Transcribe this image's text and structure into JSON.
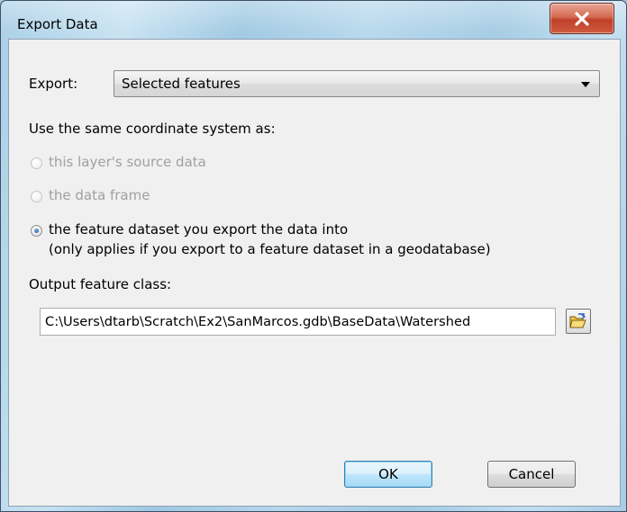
{
  "window": {
    "title": "Export Data"
  },
  "export": {
    "label": "Export:",
    "selected": "Selected features"
  },
  "coord": {
    "heading": "Use the same coordinate system as:",
    "options": [
      {
        "label": "this layer's source data",
        "state": "disabled"
      },
      {
        "label": "the data frame",
        "state": "disabled"
      },
      {
        "label": "the feature dataset you export the data into",
        "sublabel": "(only applies if you export to a feature dataset in a geodatabase)",
        "state": "selected"
      }
    ]
  },
  "output": {
    "label": "Output feature class:",
    "value": "C:\\Users\\dtarb\\Scratch\\Ex2\\SanMarcos.gdb\\BaseData\\Watershed"
  },
  "buttons": {
    "ok": "OK",
    "cancel": "Cancel"
  },
  "icons": {
    "close": "close-icon",
    "browse": "folder-open-icon"
  }
}
